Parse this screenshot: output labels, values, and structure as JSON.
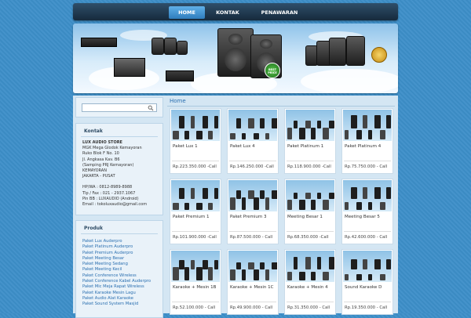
{
  "nav": {
    "items": [
      {
        "label": "HOME",
        "active": true
      },
      {
        "label": "KONTAK",
        "active": false
      },
      {
        "label": "PENAWARAN",
        "active": false
      }
    ]
  },
  "banner": {
    "badge_text": "BEST PRICE"
  },
  "search": {
    "placeholder": ""
  },
  "kontak": {
    "title": "Kontak",
    "store_name": "LUX AUDIO STORE",
    "lines": [
      "MGK Mega Glodok Kemayoran",
      "Ruko Blok F No. 10",
      "Jl. Angkasa Kav. B6",
      "(Samping PRJ Kemayoran)",
      "KEMAYORAN",
      "JAKARTA - PUSAT"
    ],
    "contact_lines": [
      "HP/WA : 0812-8989-8988",
      "Tlp / Fax : 021 - 2937.1067",
      "Pin BB : LUXAUDIO (Android)",
      "Email : tokoluxaudio@gmail.com"
    ]
  },
  "produk": {
    "title": "Produk",
    "items": [
      "Paket Lux Auderpro",
      "Paket Platinum Auderpro",
      "Paket Premium Auderpro",
      "Paket Meeting Besar",
      "Paket Meeting Sedang",
      "Paket Meeting Kecil",
      "Paket Conference Wireless",
      "Paket Conference Kabel Auderpro",
      "Paket Mic Meja Rapat Wireless",
      "Paket Karaoke Mesin Lagu",
      "Paket Audio Alat Karaoke",
      "Paket Sound System Masjid"
    ]
  },
  "breadcrumb": "Home",
  "products": [
    {
      "name": "Paket Lux 1",
      "price": "Rp.223.350.000 -Call"
    },
    {
      "name": "Paket Lux 4",
      "price": "Rp.146.250.000 -Call"
    },
    {
      "name": "Paket Platinum 1",
      "price": "Rp.118.900.000 -Call"
    },
    {
      "name": "Paket Platinum 4",
      "price": "Rp.75.750.000 - Call"
    },
    {
      "name": "Paket Premium 1",
      "price": "Rp.101.900.000 -Call"
    },
    {
      "name": "Paket Premium 3",
      "price": "Rp.87.500.000 - Call"
    },
    {
      "name": "Meeting Besar 1",
      "price": "Rp.68.350.000 -Call"
    },
    {
      "name": "Meeting Besar 5",
      "price": "Rp.42.600.000 - Call"
    },
    {
      "name": "Karaoke + Mesin 1B",
      "price": "Rp.52.100.000 - Call"
    },
    {
      "name": "Karaoke + Mesin 1C",
      "price": "Rp.49.900.000 - Call"
    },
    {
      "name": "Karaoke + Mesin 4",
      "price": "Rp.31.350.000 - Call"
    },
    {
      "name": "Sound Karaoke D",
      "price": "Rp.19.350.000 - Call"
    }
  ]
}
